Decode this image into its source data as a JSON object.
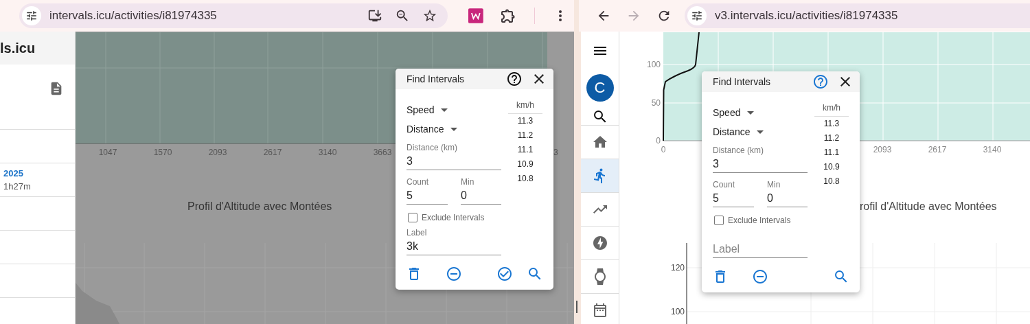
{
  "left_window": {
    "address_bar": {
      "url": "intervals.icu/activities/i81974335"
    },
    "sidebar": {
      "brand": "ls.icu",
      "activity": {
        "date": "2025",
        "duration": "1h27m"
      }
    },
    "backdrop": true,
    "chart": {
      "x_ticks": [
        "1047",
        "1570",
        "2093",
        "2617",
        "3140",
        "3663",
        "3"
      ],
      "title": "Profil d'Altitude avec Montées"
    },
    "dialog": {
      "title": "Find Intervals",
      "help_highlighted": false,
      "selects": [
        "Speed",
        "Distance"
      ],
      "distance": {
        "label": "Distance (km)",
        "value": "3"
      },
      "count": {
        "label": "Count",
        "value": "5"
      },
      "min": {
        "label": "Min",
        "value": "0"
      },
      "exclude": {
        "label": "Exclude Intervals",
        "checked": false
      },
      "label_field": {
        "label": "Label",
        "value": "3k"
      },
      "results": {
        "header": "km/h",
        "values": [
          "11.3",
          "11.2",
          "11.1",
          "10.9",
          "10.8"
        ]
      },
      "actions": [
        {
          "kind": "delete"
        },
        {
          "kind": "remove"
        },
        {
          "kind": "confirm"
        },
        {
          "kind": "search"
        }
      ]
    }
  },
  "right_window": {
    "nav_buttons": [
      {
        "kind": "back",
        "disabled": false
      },
      {
        "kind": "forward",
        "disabled": true
      },
      {
        "kind": "reload",
        "disabled": false
      }
    ],
    "address_bar": {
      "url": "v3.intervals.icu/activities/i81974335"
    },
    "backdrop": false,
    "nav": {
      "avatar": "C",
      "items": [
        {
          "kind": "home",
          "selected": false
        },
        {
          "kind": "activity",
          "selected": true
        },
        {
          "kind": "trend",
          "selected": false
        },
        {
          "kind": "power",
          "selected": false
        },
        {
          "kind": "watch",
          "selected": false
        },
        {
          "kind": "calendar",
          "selected": false
        }
      ]
    },
    "chart": {
      "y_ticks": [
        "100",
        "50",
        "0"
      ],
      "x_ticks": [
        "0",
        "2093",
        "2617",
        "3140"
      ],
      "title": "rofil d'Altitude avec Montées",
      "lower_y_ticks": [
        "120",
        "100"
      ]
    },
    "dialog": {
      "title": "Find Intervals",
      "help_highlighted": true,
      "selects": [
        "Speed",
        "Distance"
      ],
      "distance": {
        "label": "Distance (km)",
        "value": "3"
      },
      "count": {
        "label": "Count",
        "value": "5"
      },
      "min": {
        "label": "Min",
        "value": "0"
      },
      "exclude": {
        "label": "Exclude Intervals",
        "checked": false
      },
      "label_field": {
        "placeholder": "Label"
      },
      "results": {
        "header": "km/h",
        "values": [
          "11.3",
          "11.2",
          "11.1",
          "10.9",
          "10.8"
        ]
      },
      "actions": [
        {
          "kind": "delete"
        },
        {
          "kind": "remove"
        },
        {
          "kind": "search"
        }
      ]
    }
  }
}
